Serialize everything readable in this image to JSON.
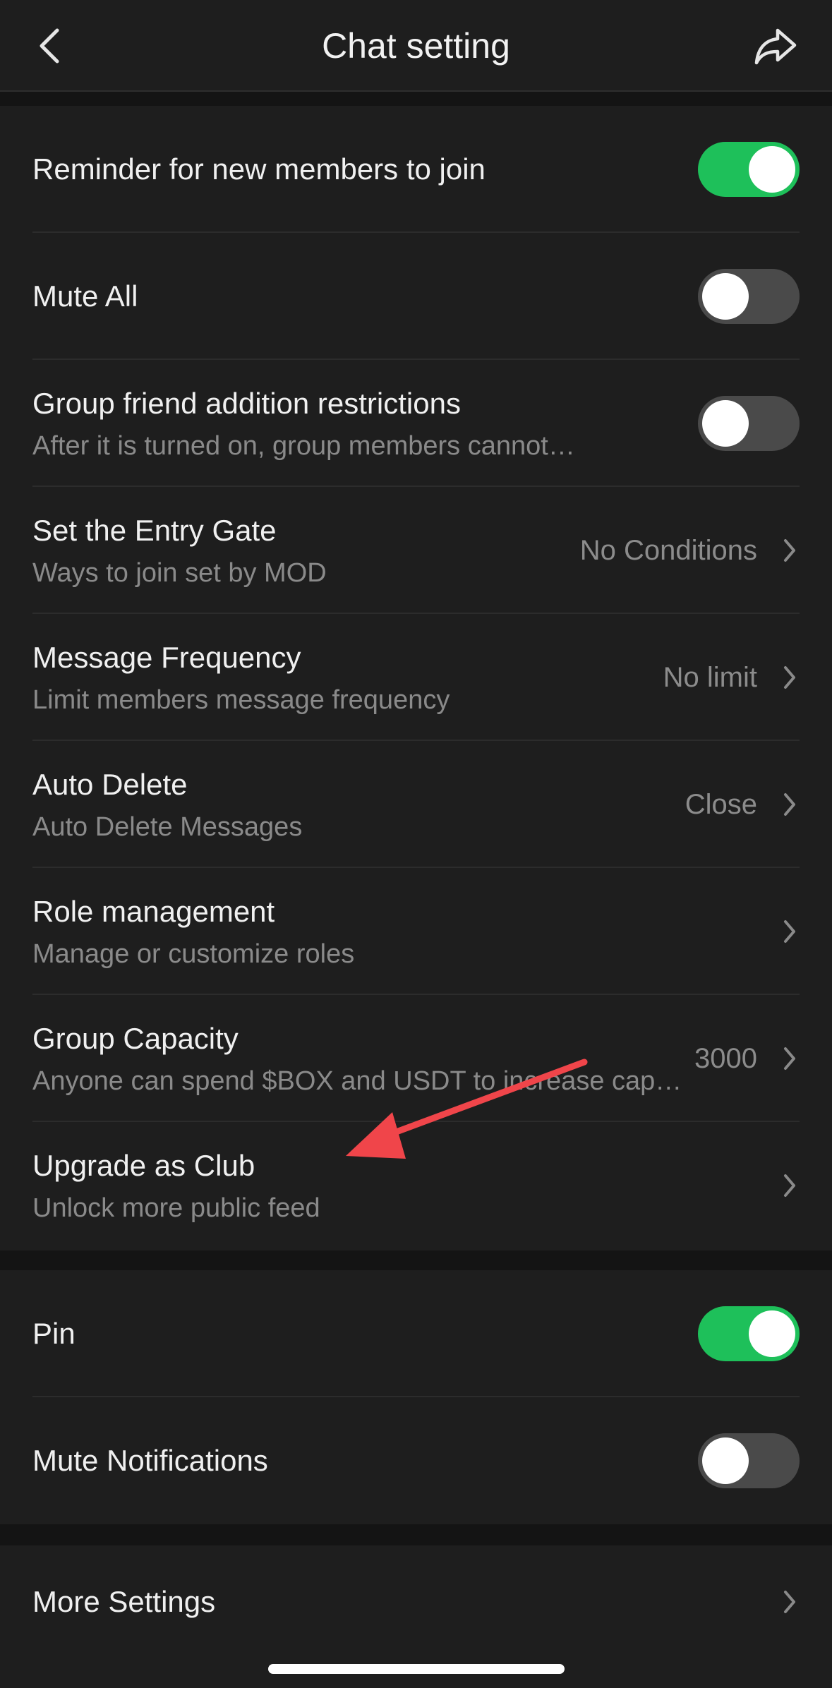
{
  "header": {
    "title": "Chat setting",
    "back_icon": "chevron-left-icon",
    "share_icon": "share-icon"
  },
  "group_settings": {
    "reminder": {
      "title": "Reminder for new members to join",
      "enabled": true
    },
    "mute_all": {
      "title": "Mute All",
      "enabled": false
    },
    "friend_restrictions": {
      "title": "Group friend addition restrictions",
      "subtitle": "After it is turned on, group members cannot…",
      "enabled": false
    },
    "entry_gate": {
      "title": "Set the Entry Gate",
      "subtitle": "Ways to join set by MOD",
      "value": "No Conditions"
    },
    "message_frequency": {
      "title": "Message Frequency",
      "subtitle": "Limit members message frequency",
      "value": "No limit"
    },
    "auto_delete": {
      "title": "Auto Delete",
      "subtitle": "Auto Delete Messages",
      "value": "Close"
    },
    "role_management": {
      "title": "Role management",
      "subtitle": "Manage or customize roles"
    },
    "group_capacity": {
      "title": "Group Capacity",
      "subtitle": "Anyone can spend $BOX and USDT to increase cap…",
      "value": "3000"
    },
    "upgrade_club": {
      "title": "Upgrade as Club",
      "subtitle": "Unlock more public feed"
    }
  },
  "chat_settings": {
    "pin": {
      "title": "Pin",
      "enabled": true
    },
    "mute_notifications": {
      "title": "Mute Notifications",
      "enabled": false
    }
  },
  "more": {
    "title": "More Settings"
  },
  "colors": {
    "background": "#141414",
    "card": "#1e1e1e",
    "toggle_on": "#1ec05a",
    "toggle_off": "#4a4a4a",
    "annotation_arrow": "#f0454a"
  }
}
